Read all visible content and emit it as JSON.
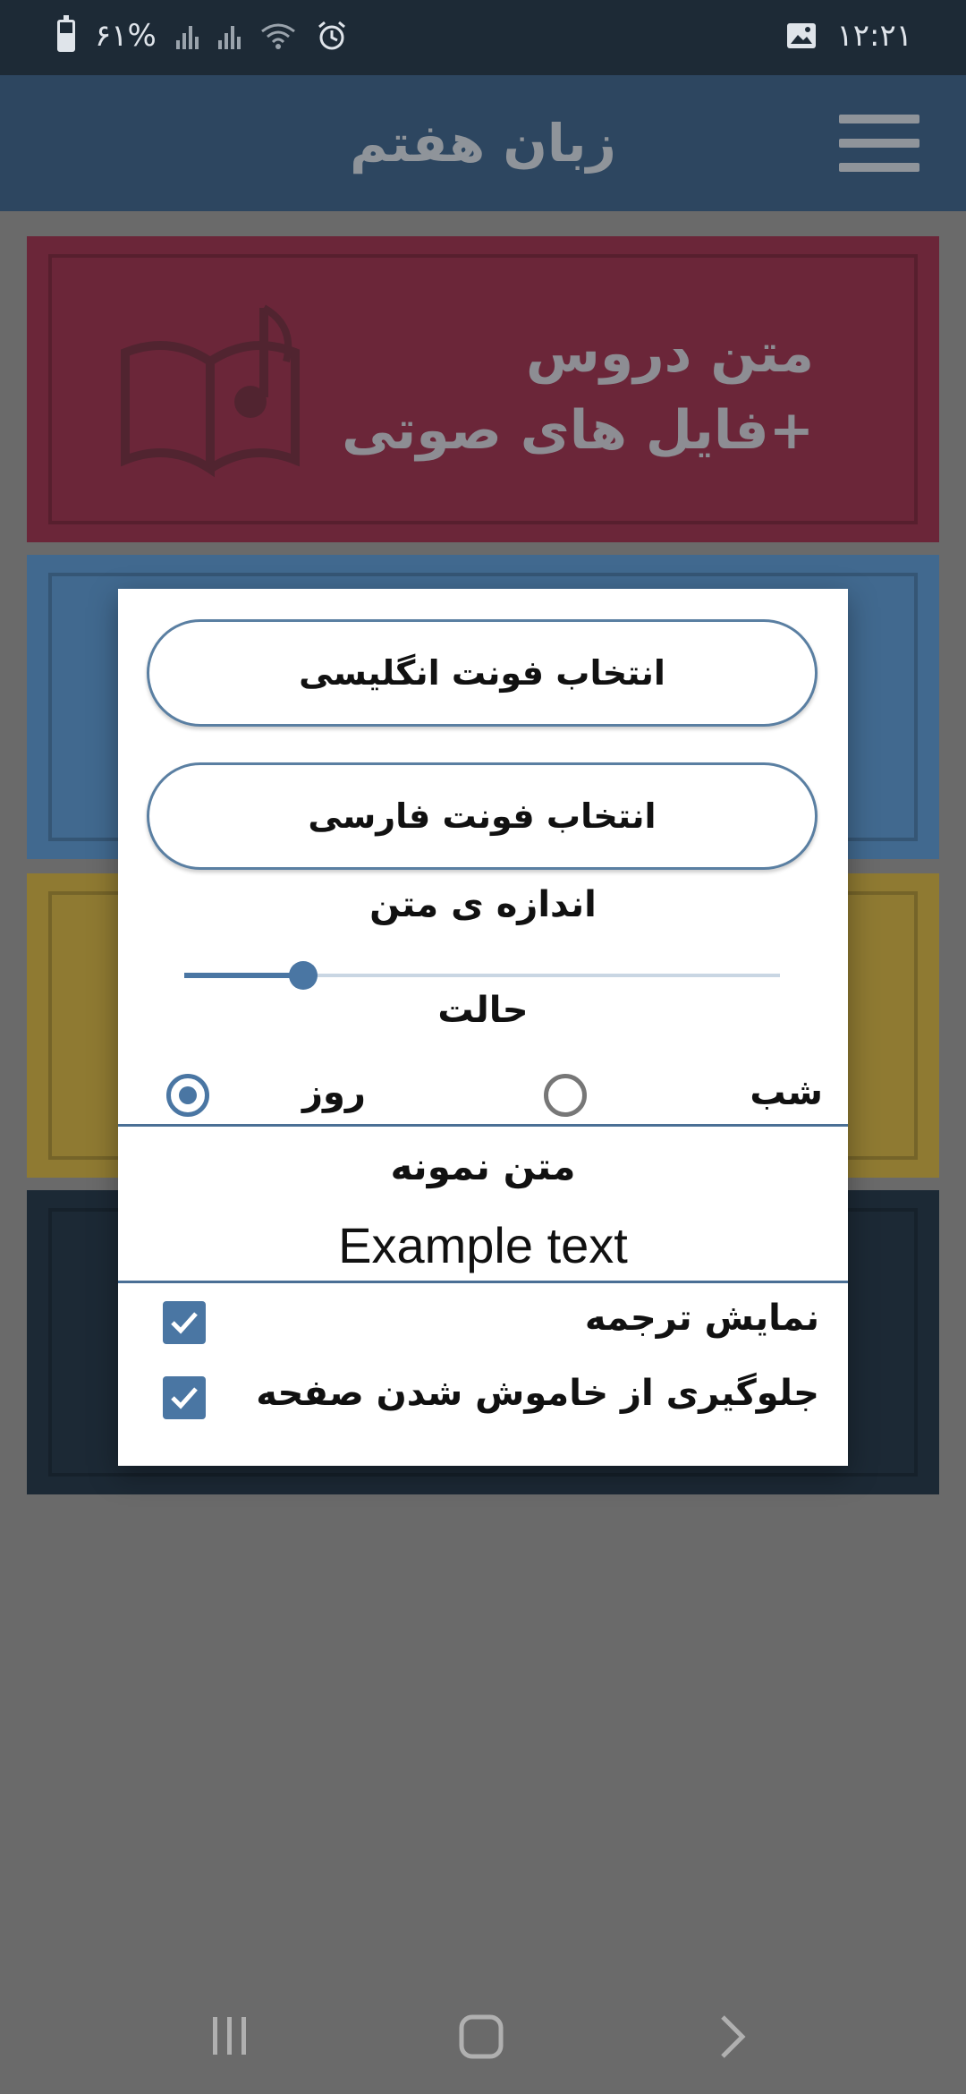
{
  "status_bar": {
    "battery_text": "۶۱%",
    "battery_level": 0.61,
    "time": "۱۲:۲۱"
  },
  "app_bar": {
    "title": "زبان هفتم"
  },
  "cards": {
    "lessons_title_line1": "متن دروس",
    "lessons_title_line2": "+فایل های صوتی"
  },
  "dialog": {
    "english_font_button": "انتخاب فونت انگلیسی",
    "persian_font_button": "انتخاب فونت فارسی",
    "text_size_label": "اندازه ی متن",
    "text_size_value": 0.2,
    "mode_label": "حالت",
    "mode_day": "روز",
    "mode_night": "شب",
    "mode_selected": "روز",
    "sample_title": "متن نمونه",
    "sample_text": "Example text",
    "show_translation": "نمایش ترجمه",
    "show_translation_checked": true,
    "keep_screen_on": "جلوگیری از خاموش شدن صفحه",
    "keep_screen_on_checked": true
  },
  "colors": {
    "accent": "#4a76a3",
    "appbar": "#2d4660",
    "card_red": "#6b2639",
    "card_blue": "#41698f",
    "card_yellow": "#8f7a32",
    "card_dark": "#1c2935"
  }
}
